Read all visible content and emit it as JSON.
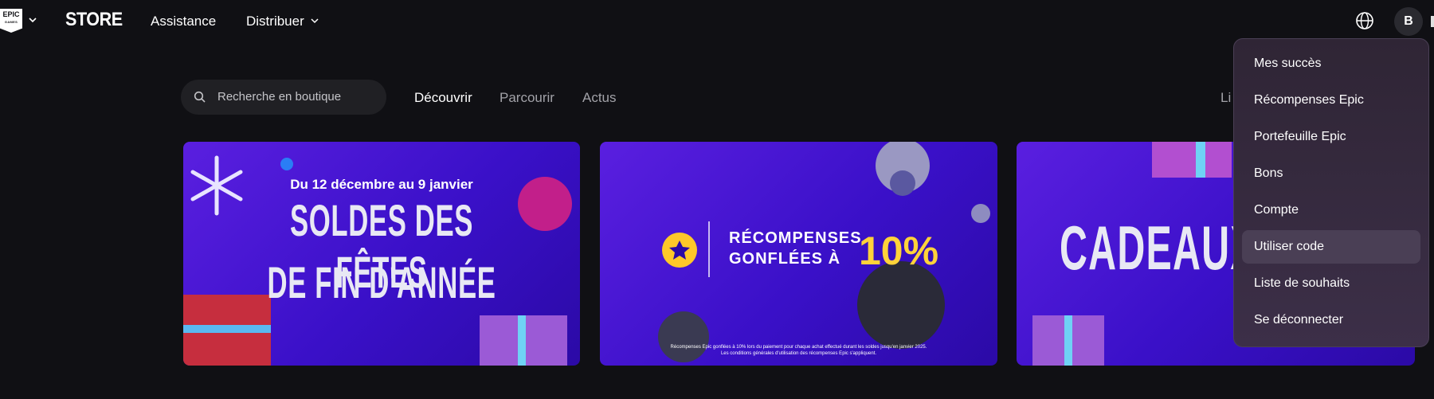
{
  "header": {
    "logo_text": "EPIC",
    "logo_subtext": "GAMES",
    "store_label": "STORE",
    "nav": {
      "assistance": "Assistance",
      "distribuer": "Distribuer"
    },
    "avatar_initial": "B"
  },
  "subnav": {
    "search_placeholder": "Recherche en boutique",
    "tabs": [
      "Découvrir",
      "Parcourir",
      "Actus"
    ],
    "partial_right": "Li"
  },
  "banners": [
    {
      "date": "Du 12 décembre au 9 janvier",
      "line1": "SOLDES DES FÊTES",
      "line2": "DE FIN D'ANNÉE"
    },
    {
      "line1": "RÉCOMPENSES",
      "line2": "GONFLÉES À",
      "percent": "10%",
      "fine1": "Récompenses Epic gonflées à 10% lors du paiement pour chaque achat effectué durant les soldes jusqu'en janvier 2025.",
      "fine2": "Les conditions générales d'utilisation des récompenses Epic s'appliquent."
    },
    {
      "title": "CADEAUX S"
    }
  ],
  "dropdown": {
    "items": [
      "Mes succès",
      "Récompenses Epic",
      "Portefeuille Epic",
      "Bons",
      "Compte",
      "Utiliser code",
      "Liste de souhaits",
      "Se déconnecter"
    ],
    "highlighted": "Utiliser code"
  },
  "colors": {
    "background": "#101014",
    "banner_purple": "#4a16d6",
    "menu_bg": "#3a2e44",
    "accent_yellow": "#ffd23a"
  }
}
